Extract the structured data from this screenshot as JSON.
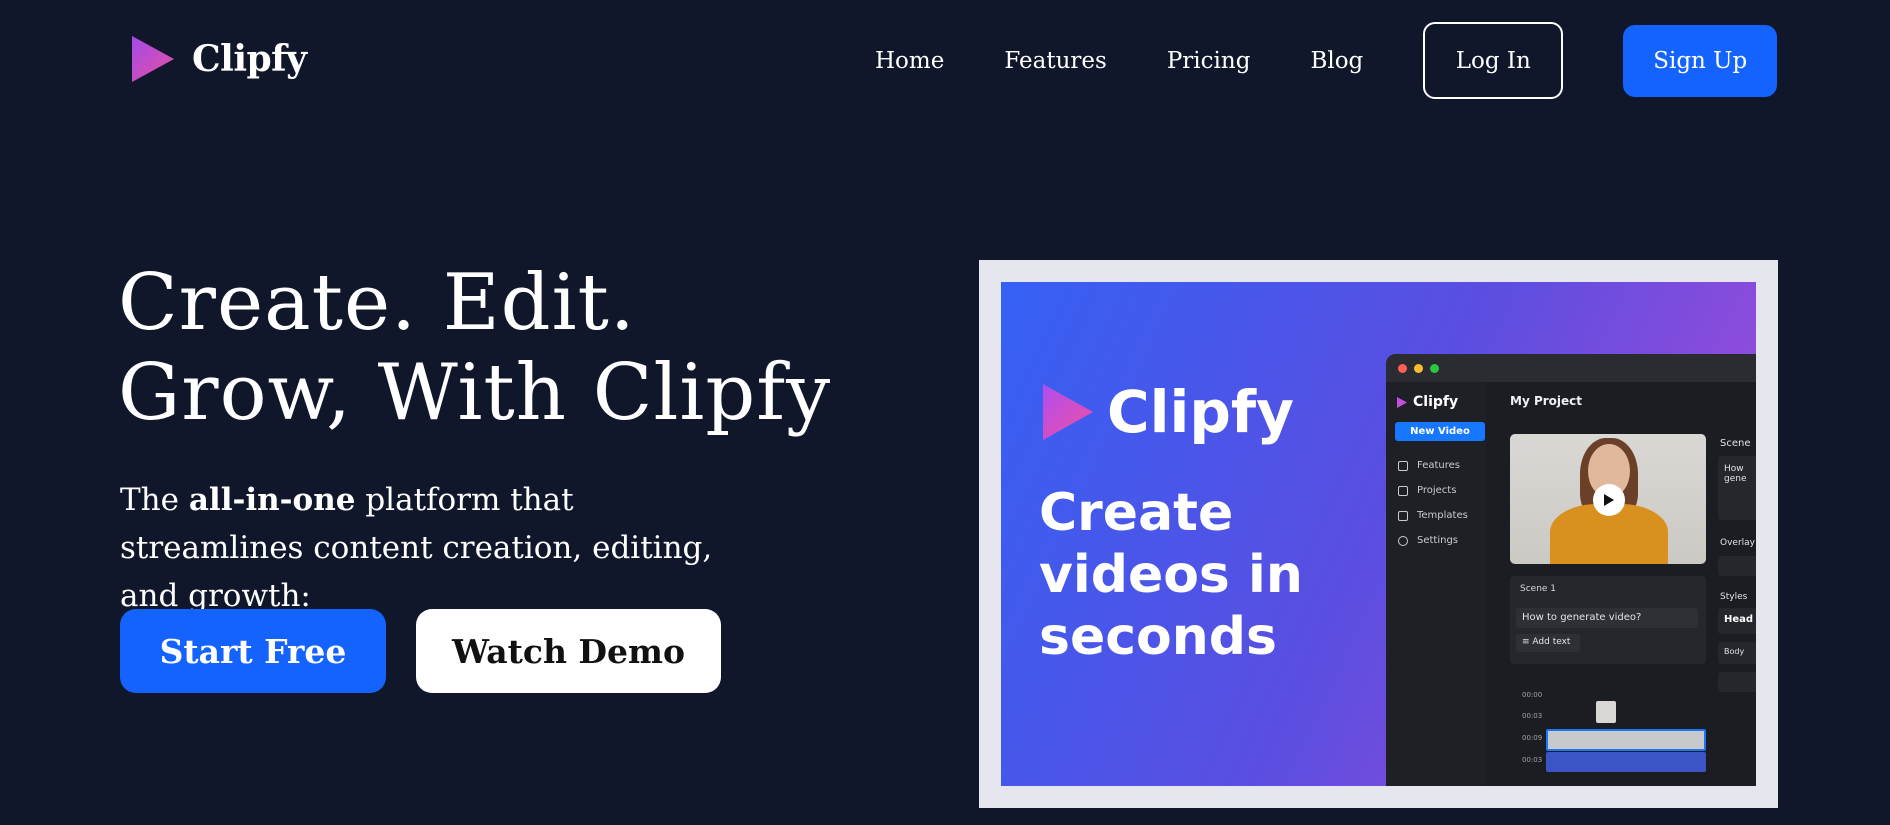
{
  "brand": {
    "name": "Clipfy"
  },
  "nav": {
    "links": [
      "Home",
      "Features",
      "Pricing",
      "Blog"
    ],
    "login": "Log In",
    "signup": "Sign Up"
  },
  "hero": {
    "title_line1": "Create. Edit.",
    "title_line2": "Grow, With Clipfy",
    "sub_pre": "The ",
    "sub_bold": "all-in-one",
    "sub_post": " platform that streamlines content creation, editing, and growth:",
    "cta_primary": "Start Free",
    "cta_secondary": "Watch Demo"
  },
  "mockup": {
    "banner_brand": "Clipfy",
    "headline": "Create videos in seconds",
    "app": {
      "brand": "Clipfy",
      "new_video": "New Video",
      "sidebar": [
        "Features",
        "Projects",
        "Templates",
        "Settings"
      ],
      "project_title": "My Project",
      "scene_label": "Scene 1",
      "prompt": "How to generate video?",
      "add_text": "Add text",
      "timeline_times": [
        "00:00",
        "00:03",
        "00:09",
        "00:03"
      ],
      "right_panel": {
        "scene": "Scene",
        "scene_text": "How gene",
        "overlay": "Overlay",
        "styles": "Styles",
        "heading": "Head",
        "body": "Body"
      }
    }
  },
  "colors": {
    "background": "#10172a",
    "primary": "#1463ff",
    "accent_gradient_start": "#3560f4",
    "accent_gradient_end": "#b04ad8"
  }
}
